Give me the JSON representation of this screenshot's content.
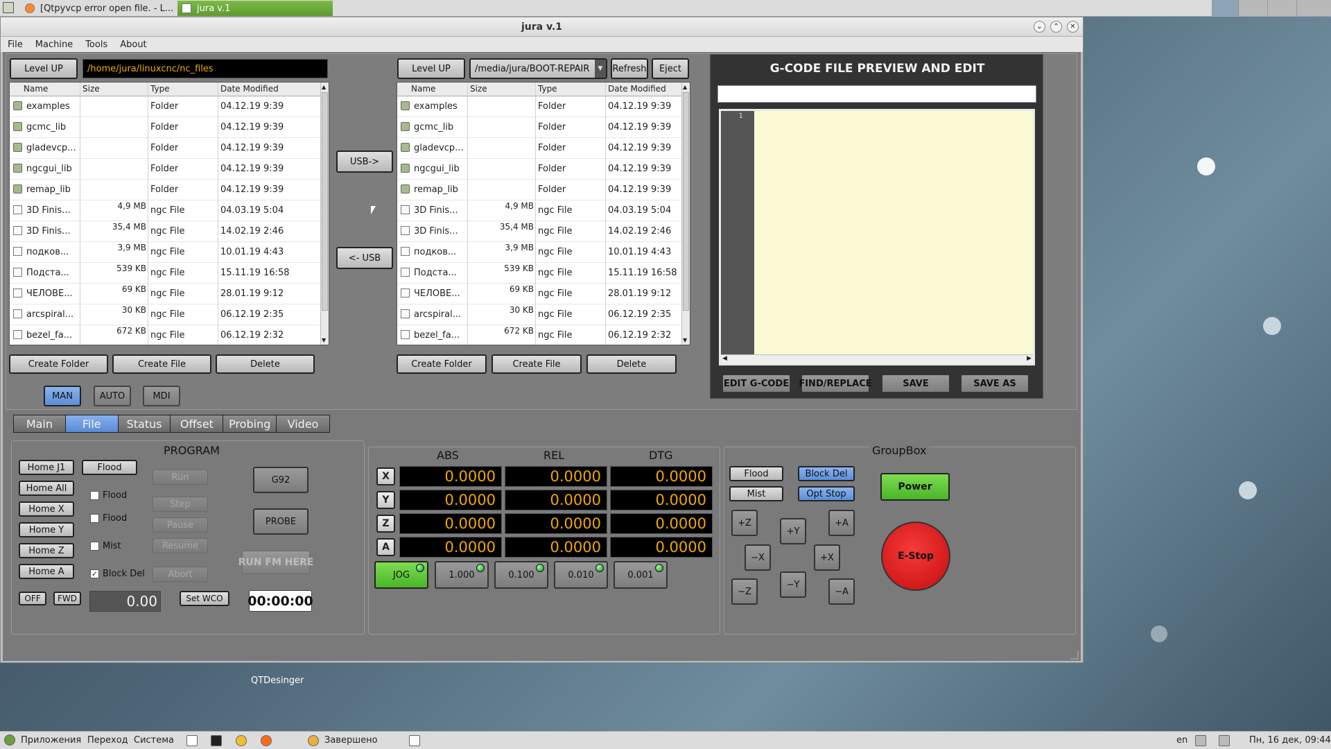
{
  "topbar": {
    "tasks": [
      {
        "label": "[Qtpyvcp error open file. - L..."
      },
      {
        "label": "jura v.1"
      }
    ]
  },
  "window": {
    "title": "jura v.1",
    "menu": [
      "File",
      "Machine",
      "Tools",
      "About"
    ]
  },
  "left_browser": {
    "level_up": "Level UP",
    "path": "/home/jura/linuxcnc/nc_files",
    "headers": [
      "Name",
      "Size",
      "Type",
      "Date Modified"
    ],
    "rows": [
      {
        "name": "examples",
        "size": "",
        "type": "Folder",
        "date": "04.12.19 9:39",
        "kind": "folder"
      },
      {
        "name": "gcmc_lib",
        "size": "",
        "type": "Folder",
        "date": "04.12.19 9:39",
        "kind": "folder"
      },
      {
        "name": "gladevcp...",
        "size": "",
        "type": "Folder",
        "date": "04.12.19 9:39",
        "kind": "folder"
      },
      {
        "name": "ngcgui_lib",
        "size": "",
        "type": "Folder",
        "date": "04.12.19 9:39",
        "kind": "folder"
      },
      {
        "name": "remap_lib",
        "size": "",
        "type": "Folder",
        "date": "04.12.19 9:39",
        "kind": "folder"
      },
      {
        "name": "3D Finis...",
        "size": "4,9 MB",
        "type": "ngc File",
        "date": "04.03.19 5:04",
        "kind": "file"
      },
      {
        "name": "3D Finis...",
        "size": "35,4 MB",
        "type": "ngc File",
        "date": "14.02.19 2:46",
        "kind": "file"
      },
      {
        "name": "подков...",
        "size": "3,9 MB",
        "type": "ngc File",
        "date": "10.01.19 4:43",
        "kind": "file"
      },
      {
        "name": "Подста...",
        "size": "539 KB",
        "type": "ngc File",
        "date": "15.11.19 16:58",
        "kind": "file"
      },
      {
        "name": "ЧЕЛОВЕ...",
        "size": "69 KB",
        "type": "ngc File",
        "date": "28.01.19 9:12",
        "kind": "file"
      },
      {
        "name": "arcspiral...",
        "size": "30 KB",
        "type": "ngc File",
        "date": "06.12.19 2:35",
        "kind": "file"
      },
      {
        "name": "bezel_fa...",
        "size": "672 KB",
        "type": "ngc File",
        "date": "06.12.19 2:32",
        "kind": "file"
      }
    ],
    "create_folder": "Create Folder",
    "create_file": "Create File",
    "delete": "Delete"
  },
  "transfer": {
    "to_usb": "USB->",
    "from_usb": "<- USB"
  },
  "right_browser": {
    "level_up": "Level UP",
    "path": "/media/jura/BOOT-REPAIR",
    "refresh": "Refresh",
    "eject": "Eject",
    "create_folder": "Create Folder",
    "create_file": "Create File",
    "delete": "Delete"
  },
  "gcode": {
    "title": "G-CODE FILE PREVIEW AND EDIT",
    "line_number": "1",
    "edit": "EDIT G-CODE",
    "find": "FIND/REPLACE",
    "save": "SAVE",
    "save_as": "SAVE AS"
  },
  "modes": [
    "MAN",
    "AUTO",
    "MDI"
  ],
  "tabs": [
    "Main",
    "File",
    "Status",
    "Offset",
    "Probing",
    "Video"
  ],
  "program": {
    "title": "PROGRAM",
    "home": [
      "Home J1",
      "Home All",
      "Home X",
      "Home Y",
      "Home Z",
      "Home A"
    ],
    "flood_btn": "Flood",
    "checks": [
      {
        "label": "Flood",
        "checked": false
      },
      {
        "label": "Flood",
        "checked": false
      },
      {
        "label": "Mist",
        "checked": false
      },
      {
        "label": "Block Del",
        "checked": true
      }
    ],
    "check_mark": "✓",
    "run_controls": [
      "Run",
      "Step",
      "Pause",
      "Resume",
      "Abort"
    ],
    "g92": "G92",
    "probe": "PROBE",
    "run_from_here": "RUN FM HERE",
    "off": "OFF",
    "fwd": "FWD",
    "spindle": "0.00",
    "set_wco": "Set WCO",
    "timer": "00:00:00"
  },
  "dro": {
    "headers": [
      "ABS",
      "REL",
      "DTG"
    ],
    "axes": [
      {
        "axis": "X",
        "abs": "0.0000",
        "rel": "0.0000",
        "dtg": "0.0000"
      },
      {
        "axis": "Y",
        "abs": "0.0000",
        "rel": "0.0000",
        "dtg": "0.0000"
      },
      {
        "axis": "Z",
        "abs": "0.0000",
        "rel": "0.0000",
        "dtg": "0.0000"
      },
      {
        "axis": "A",
        "abs": "0.0000",
        "rel": "0.0000",
        "dtg": "0.0000"
      }
    ],
    "jog": "JOG",
    "increments": [
      "1.000",
      "0.100",
      "0.010",
      "0.001"
    ]
  },
  "groupbox": {
    "title": "GroupBox",
    "flood": "Flood",
    "block_del": "Block Del",
    "mist": "Mist",
    "opt_stop": "Opt Stop",
    "power": "Power",
    "estop": "E-Stop",
    "jog": {
      "pz": "+Z",
      "py": "+Y",
      "pa": "+A",
      "mx": "−X",
      "px": "+X",
      "mz": "−Z",
      "my": "−Y",
      "ma": "−A"
    }
  },
  "desktop": {
    "icon_label": "QTDesinger"
  },
  "taskbar": {
    "apps": "Приложения",
    "places": "Переход",
    "system": "Система",
    "status": "Завершено",
    "lang": "en",
    "clock": "Пн, 16 дек, 09:44"
  },
  "colors": {
    "accent_blue": "#5b8ed9",
    "dro_text": "#f0a800",
    "estop": "#e01818",
    "power": "#49b52a",
    "editor_bg": "#fbfad5"
  }
}
